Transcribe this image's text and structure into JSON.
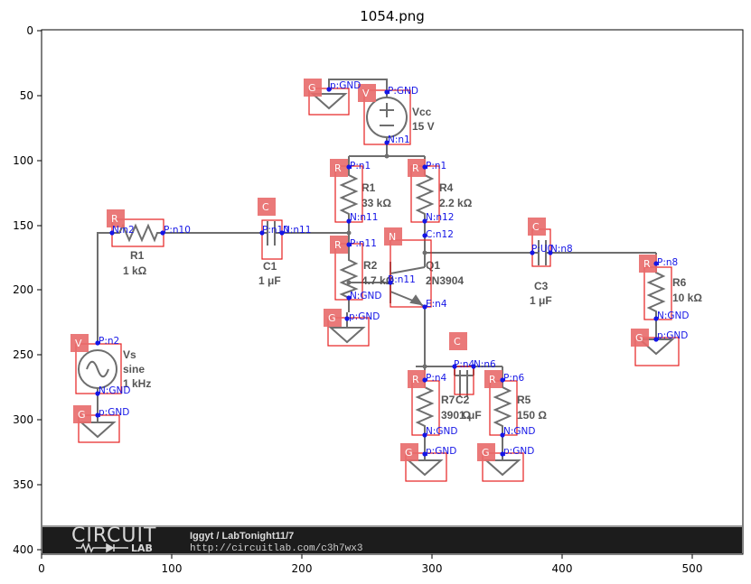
{
  "title": "1054.png",
  "x_ticks": [
    "0",
    "100",
    "200",
    "300",
    "400",
    "500"
  ],
  "y_ticks": [
    "0",
    "50",
    "100",
    "150",
    "200",
    "250",
    "300",
    "350",
    "400"
  ],
  "components": {
    "vcc": {
      "name": "Vcc",
      "value": "15 V"
    },
    "r1": {
      "name": "R1",
      "value": "33 kΩ"
    },
    "r4": {
      "name": "R4",
      "value": "2.2 kΩ"
    },
    "r1in": {
      "name": "R1",
      "value": "1 kΩ"
    },
    "c1": {
      "name": "C1",
      "value": "1 μF"
    },
    "r2": {
      "name": "R2",
      "value": "4.7 kΩ"
    },
    "q1": {
      "name": "Q1",
      "value": "2N3904"
    },
    "c3": {
      "name": "C3",
      "value": "1 μF"
    },
    "r6": {
      "name": "R6",
      "value": "10 kΩ"
    },
    "vs": {
      "name": "Vs",
      "value": "sine",
      "value2": "1 kHz"
    },
    "r7": {
      "name": "R7",
      "value": "390 Ω"
    },
    "c2": {
      "name": "C2",
      "value": "1 μF"
    },
    "r5": {
      "name": "R5",
      "value": "150 Ω"
    }
  },
  "badges": {
    "g1": "G",
    "vcc": "V",
    "r1": "R",
    "r4": "R",
    "rin": "R",
    "c1": "C",
    "r2": "R",
    "q": "N",
    "c3": "C",
    "r6": "R",
    "vs": "V",
    "g_vs": "G",
    "g_r2": "G",
    "c2": "C",
    "r7": "R",
    "r5": "R",
    "g_r7": "G",
    "g_r5": "G",
    "g_r6": "G"
  },
  "pins": {
    "g1_p": "p:GND",
    "vcc_p": "P:GND",
    "vcc_n": "N:n1",
    "r1_p": "P:n1",
    "r1_n": "N:n11",
    "r4_p": "P:n1",
    "r4_n": "N:n12",
    "rin_n": "N:n2",
    "rin_p": "P:n10",
    "c1_p": "P:n10",
    "c1_n": "N:n11",
    "r2_p": "P:n11",
    "r2_n": "N:GND",
    "q_c": "C:n12",
    "q_b": "B:n11",
    "q_e": "E:n4",
    "c3_p": "P:U0",
    "c3_n": "N:n8",
    "r6_p": "P:n8",
    "r6_n": "N:GND",
    "g_r6_p": "p:GND",
    "g_r2_p": "p:GND",
    "vs_p": "P:n2",
    "vs_n": "N:GND",
    "g_vs_p": "p:GND",
    "c2_p": "P:n4",
    "c2_n": "N:n6",
    "r7_p": "P:n4",
    "r7_n": "N:GND",
    "r5_p": "P:n6",
    "r5_n": "N:GND",
    "g_r7_p": "p:GND",
    "g_r5_p": "p:GND"
  },
  "footer": {
    "logo_top": "CIRCUIT",
    "logo_bottom": "LAB",
    "credit_line1": "Iggyt / LabTonight11/7",
    "credit_line2": "http://circuitlab.com/c3h7wx3"
  },
  "colors": {
    "wire": "#6e6e6e",
    "pin": "#1515e6",
    "box": "#e62020",
    "badge": "#e86a6a",
    "banner": "#1c1c1c"
  }
}
